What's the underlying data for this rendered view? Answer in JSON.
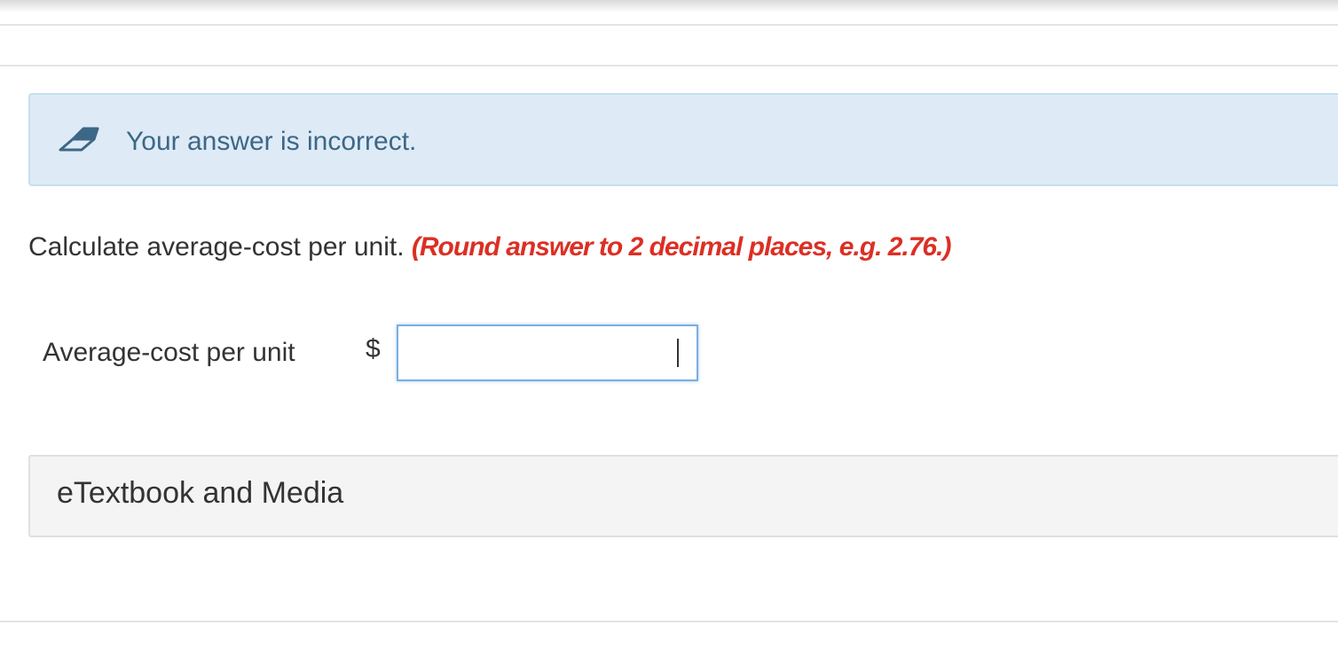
{
  "feedback": {
    "icon": "eraser-icon",
    "message": "Your answer is incorrect.",
    "colors": {
      "background": "#deebf6",
      "text": "#3d6787"
    }
  },
  "question": {
    "text": "Calculate average-cost per unit.",
    "hint": "(Round answer to 2 decimal places, e.g. 2.76.)",
    "hint_color": "#dc2f24"
  },
  "answer_field": {
    "label": "Average-cost per unit",
    "currency_symbol": "$",
    "value": "",
    "placeholder": ""
  },
  "resources": {
    "label": "eTextbook and Media"
  }
}
